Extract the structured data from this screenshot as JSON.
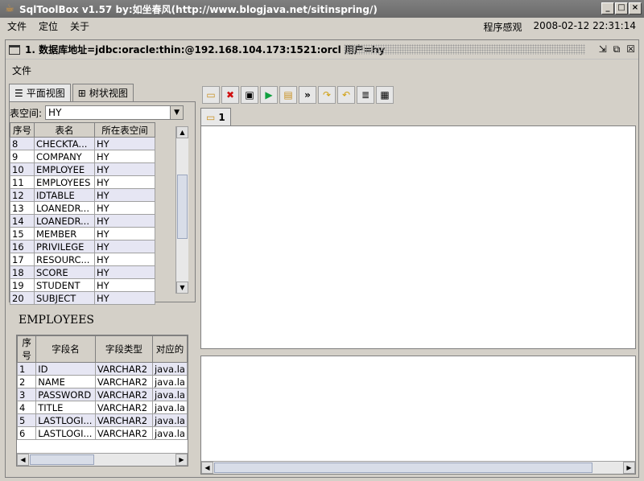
{
  "app": {
    "title": "SqlToolBox v1.57 by:如坐春风(http://www.blogjava.net/sitinspring/)",
    "menu": [
      "文件",
      "定位",
      "关于"
    ],
    "right_items": [
      "程序感观",
      "2008-02-12 22:31:14"
    ]
  },
  "connection_window": {
    "title": "1. 数据库地址=jdbc:oracle:thin:@192.168.104.173:1521:orcl 用户=hy",
    "menu": [
      "文件"
    ]
  },
  "left_tabs": [
    "平面视图",
    "树状视图"
  ],
  "tablespace": {
    "label": "表空间:",
    "value": "HY"
  },
  "table_list": {
    "headers": [
      "序号",
      "表名",
      "所在表空间"
    ],
    "rows": [
      [
        "8",
        "CHECKTA...",
        "HY"
      ],
      [
        "9",
        "COMPANY",
        "HY"
      ],
      [
        "10",
        "EMPLOYEE",
        "HY"
      ],
      [
        "11",
        "EMPLOYEES",
        "HY"
      ],
      [
        "12",
        "IDTABLE",
        "HY"
      ],
      [
        "13",
        "LOANEDR...",
        "HY"
      ],
      [
        "14",
        "LOANEDR...",
        "HY"
      ],
      [
        "15",
        "MEMBER",
        "HY"
      ],
      [
        "16",
        "PRIVILEGE",
        "HY"
      ],
      [
        "17",
        "RESOURC...",
        "HY"
      ],
      [
        "18",
        "SCORE",
        "HY"
      ],
      [
        "19",
        "STUDENT",
        "HY"
      ],
      [
        "20",
        "SUBJECT",
        "HY"
      ]
    ]
  },
  "fields_panel": {
    "title": "EMPLOYEES",
    "headers": [
      "序号",
      "字段名",
      "字段类型",
      "对应的"
    ],
    "rows": [
      [
        "1",
        "ID",
        "VARCHAR2",
        "java.la"
      ],
      [
        "2",
        "NAME",
        "VARCHAR2",
        "java.la"
      ],
      [
        "3",
        "PASSWORD",
        "VARCHAR2",
        "java.la"
      ],
      [
        "4",
        "TITLE",
        "VARCHAR2",
        "java.la"
      ],
      [
        "5",
        "LASTLOGI...",
        "VARCHAR2",
        "java.la"
      ],
      [
        "6",
        "LASTLOGI...",
        "VARCHAR2",
        "java.la"
      ]
    ]
  },
  "editor_tab": {
    "label": "1"
  },
  "toolbar_icons": [
    "folder-open-icon",
    "delete-icon",
    "save-icon",
    "run-icon",
    "run-selected-icon",
    "next-icon",
    "redo-icon",
    "undo-icon",
    "format-icon",
    "explain-icon"
  ],
  "colors": {
    "title_bar": "#6a6a6a",
    "row_stripe": "#e6e6f3",
    "background": "#d4d0c8"
  }
}
